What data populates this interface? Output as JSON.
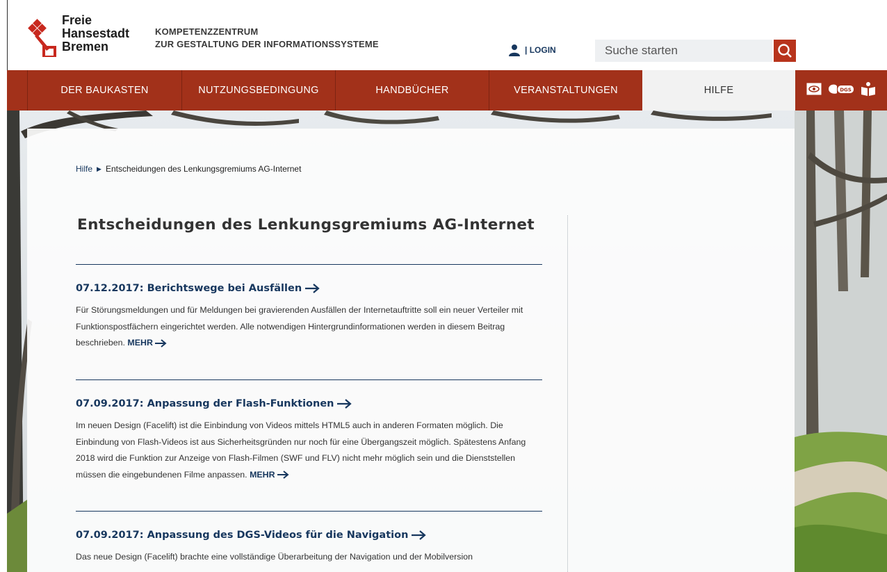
{
  "header": {
    "logo_lines": [
      "Freie",
      "Hansestadt",
      "Bremen"
    ],
    "org_line1": "KOMPETENZZENTRUM",
    "org_line2": "ZUR GESTALTUNG DER INFORMATIONSSYSTEME",
    "login_label": "| LOGIN",
    "search_placeholder": "Suche starten"
  },
  "nav": {
    "items": [
      {
        "label": "DER BAUKASTEN",
        "active": false
      },
      {
        "label": "NUTZUNGSBEDINGUNG",
        "active": false
      },
      {
        "label": "HANDBÜCHER",
        "active": false
      },
      {
        "label": "VERANSTALTUNGEN",
        "active": false
      },
      {
        "label": "HILFE",
        "active": true
      }
    ],
    "icons": [
      "eye-icon",
      "dgs-sign-language-icon",
      "easy-language-book-icon"
    ],
    "dgs_label": "DGS"
  },
  "breadcrumb": {
    "parent": "Hilfe",
    "current": "Entscheidungen des Lenkungsgremiums AG-Internet"
  },
  "main": {
    "title": "Entscheidungen des Lenkungsgremiums AG-Internet",
    "articles": [
      {
        "title": "07.12.2017: Berichtswege bei Ausfällen",
        "text": "Für Störungsmeldungen und für Meldungen bei gravierenden Ausfällen der Internetauftritte soll ein neuer Verteiler mit Funktionspostfächern eingerichtet werden. Alle notwendigen Hintergrundinformationen werden in diesem Beitrag beschrieben.",
        "more": "MEHR"
      },
      {
        "title": "07.09.2017: Anpassung der Flash-Funktionen",
        "text": "Im neuen Design (Facelift) ist die Einbindung von Videos mittels HTML5 auch in anderen Formaten möglich. Die Einbindung von Flash-Videos ist aus Sicherheitsgründen nur noch für eine Übergangszeit möglich. Spätestens Anfang 2018 wird die Funktion zur Anzeige von Flash-Filmen (SWF und FLV) nicht mehr möglich sein und die Dienststellen müssen die eingebundenen Filme anpassen.",
        "more": "MEHR"
      },
      {
        "title": "07.09.2017: Anpassung des DGS-Videos für die Navigation",
        "text": "Das neue Design (Facelift) brachte eine vollständige Überarbeitung der Navigation und der Mobilversion",
        "more": ""
      }
    ]
  },
  "colors": {
    "brand_red": "#a2311a",
    "link_blue": "#17375e",
    "search_button": "#b8341c"
  }
}
